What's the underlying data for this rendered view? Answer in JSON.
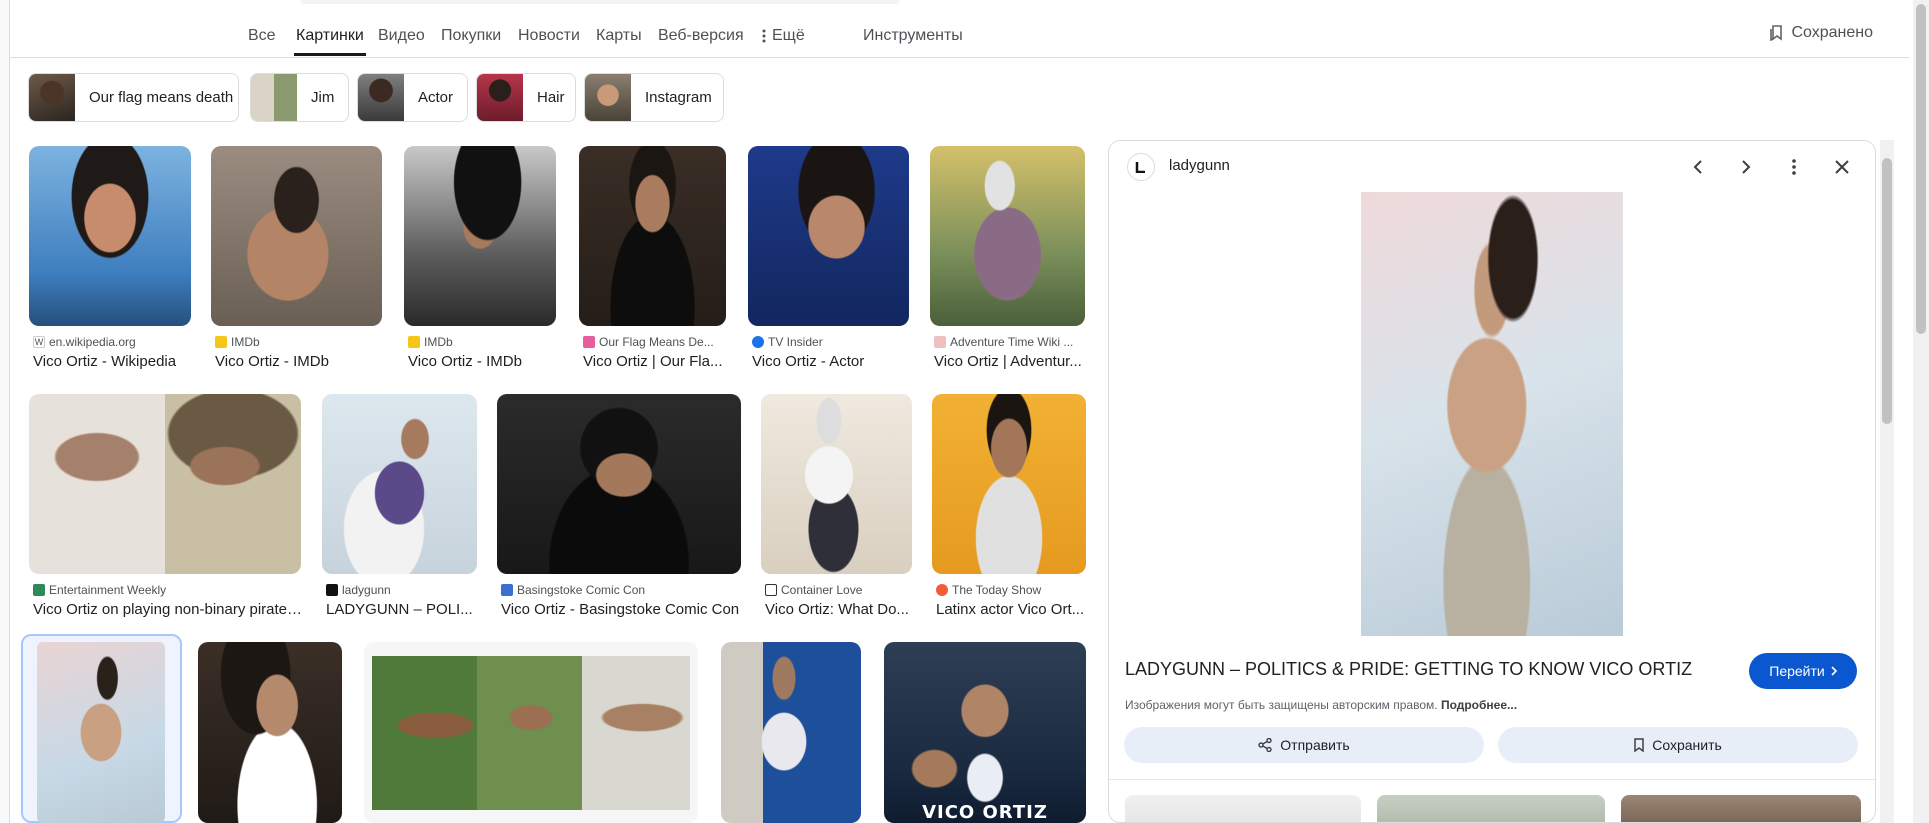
{
  "tabs": [
    {
      "label": "Все"
    },
    {
      "label": "Картинки"
    },
    {
      "label": "Видео"
    },
    {
      "label": "Покупки"
    },
    {
      "label": "Новости"
    },
    {
      "label": "Карты"
    },
    {
      "label": "Веб-версия"
    },
    {
      "label": "Ещё"
    },
    {
      "label": "Инструменты"
    }
  ],
  "saved_label": "Сохранено",
  "chips": [
    {
      "label": "Our flag means death"
    },
    {
      "label": "Jim"
    },
    {
      "label": "Actor"
    },
    {
      "label": "Hair"
    },
    {
      "label": "Instagram"
    }
  ],
  "results": [
    {
      "source": "en.wikipedia.org",
      "caption": "Vico Ortiz - Wikipedia"
    },
    {
      "source": "IMDb",
      "caption": "Vico Ortiz - IMDb"
    },
    {
      "source": "IMDb",
      "caption": "Vico Ortiz - IMDb"
    },
    {
      "source": "Our Flag Means De...",
      "caption": "Vico Ortiz | Our Fla..."
    },
    {
      "source": "TV Insider",
      "caption": "Vico Ortiz - Actor"
    },
    {
      "source": "Adventure Time Wiki ...",
      "caption": "Vico Ortiz | Adventur..."
    },
    {
      "source": "Entertainment Weekly",
      "caption": "Vico Ortiz on playing non-binary pirate ..."
    },
    {
      "source": "ladygunn",
      "caption": "LADYGUNN – POLI..."
    },
    {
      "source": "Basingstoke Comic Con",
      "caption": "Vico Ortiz - Basingstoke Comic Con"
    },
    {
      "source": "Container Love",
      "caption": "Vico Ortiz: What Do..."
    },
    {
      "source": "The Today Show",
      "caption": "Latinx actor Vico Ort..."
    }
  ],
  "poster_text": "VICO ORTIZ",
  "panel": {
    "site": "ladygunn",
    "title": "LADYGUNN – POLITICS & PRIDE: GETTING TO KNOW VICO ORTIZ",
    "goto_label": "Перейти",
    "copyright_text": "Изображения могут быть защищены авторским правом.",
    "more_link": "Подробнее...",
    "share_label": "Отправить",
    "save_label": "Сохранить"
  },
  "colors": {
    "accent": "#0b57d0",
    "pill_bg": "#e8eef8",
    "selected_border": "#a8c7fa"
  }
}
